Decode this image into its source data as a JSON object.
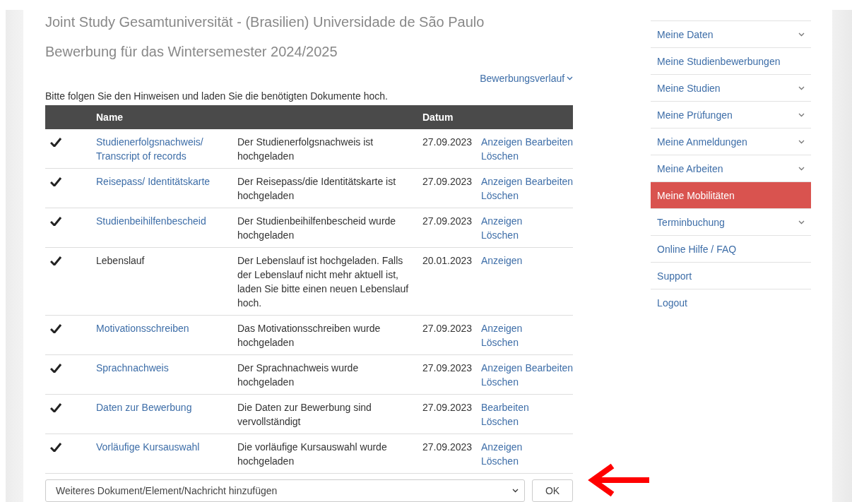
{
  "title": "Joint Study Gesamtuniversität - (Brasilien) Universidade de São Paulo",
  "subtitle": "Bewerbung für das Wintersemester 2024/2025",
  "history_link": "Bewerbungsverlauf",
  "instructions": "Bitte folgen Sie den Hinweisen und laden Sie die benötigten Dokumente hoch.",
  "table": {
    "columns": [
      "",
      "Name",
      "",
      "Datum",
      ""
    ],
    "rows": [
      {
        "done": true,
        "name": "Studienerfolgsnachweis/ Transcript of records",
        "linked": true,
        "description": "Der Studienerfolgsnachweis ist hochgeladen",
        "date": "27.09.2023",
        "action_lines": [
          [
            "Anzeigen",
            "Bearbeiten"
          ],
          [
            "Löschen"
          ]
        ]
      },
      {
        "done": true,
        "name": "Reisepass/ Identitätskarte",
        "linked": true,
        "description": "Der Reisepass/die Identitätskarte ist hochgeladen",
        "date": "27.09.2023",
        "action_lines": [
          [
            "Anzeigen",
            "Bearbeiten"
          ],
          [
            "Löschen"
          ]
        ]
      },
      {
        "done": true,
        "name": "Studienbeihilfenbescheid",
        "linked": true,
        "description": "Der Studienbeihilfenbescheid wurde hochgeladen",
        "date": "27.09.2023",
        "action_lines": [
          [
            "Anzeigen"
          ],
          [
            "Löschen"
          ]
        ]
      },
      {
        "done": true,
        "name": "Lebenslauf",
        "linked": false,
        "description": "Der Lebenslauf ist hochgeladen. Falls der Lebenslauf nicht mehr aktuell ist, laden Sie bitte einen neuen Lebenslauf hoch.",
        "date": "20.01.2023",
        "action_lines": [
          [
            "Anzeigen"
          ]
        ]
      },
      {
        "done": true,
        "name": "Motivationsschreiben",
        "linked": true,
        "description": "Das Motivationsschreiben wurde hochgeladen",
        "date": "27.09.2023",
        "action_lines": [
          [
            "Anzeigen"
          ],
          [
            "Löschen"
          ]
        ]
      },
      {
        "done": true,
        "name": "Sprachnachweis",
        "linked": true,
        "description": "Der Sprachnachweis wurde hochgeladen",
        "date": "27.09.2023",
        "action_lines": [
          [
            "Anzeigen",
            "Bearbeiten"
          ],
          [
            "Löschen"
          ]
        ]
      },
      {
        "done": true,
        "name": "Daten zur Bewerbung",
        "linked": true,
        "description": "Die Daten zur Bewerbung sind vervollständigt",
        "date": "27.09.2023",
        "action_lines": [
          [
            "Bearbeiten"
          ],
          [
            "Löschen"
          ]
        ]
      },
      {
        "done": true,
        "name": "Vorläufige Kursauswahl",
        "linked": true,
        "description": "Die vorläufige Kursauswahl wurde hochgeladen",
        "date": "27.09.2023",
        "action_lines": [
          [
            "Anzeigen"
          ],
          [
            "Löschen"
          ]
        ]
      }
    ]
  },
  "add_select": {
    "value": "Weiteres Dokument/Element/Nachricht hinzufügen"
  },
  "ok_button": "OK",
  "sidebar": {
    "items": [
      {
        "label": "Meine Daten",
        "expandable": true,
        "selected": false
      },
      {
        "label": "Meine Studienbewerbungen",
        "expandable": false,
        "selected": false
      },
      {
        "label": "Meine Studien",
        "expandable": true,
        "selected": false
      },
      {
        "label": "Meine Prüfungen",
        "expandable": true,
        "selected": false
      },
      {
        "label": "Meine Anmeldungen",
        "expandable": true,
        "selected": false
      },
      {
        "label": "Meine Arbeiten",
        "expandable": true,
        "selected": false
      },
      {
        "label": "Meine Mobilitäten",
        "expandable": false,
        "selected": true
      },
      {
        "label": "Terminbuchung",
        "expandable": true,
        "selected": false
      },
      {
        "label": "Online Hilfe / FAQ",
        "expandable": false,
        "selected": false
      },
      {
        "label": "Support",
        "expandable": false,
        "selected": false
      },
      {
        "label": "Logout",
        "expandable": false,
        "selected": false
      }
    ]
  }
}
